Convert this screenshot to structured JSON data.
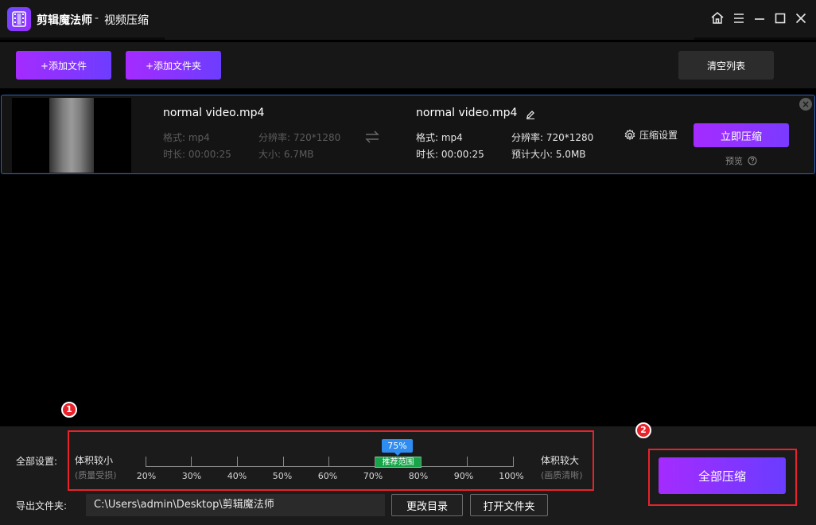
{
  "titlebar": {
    "app_name": "剪辑魔法师",
    "separator": "-",
    "page_title": "视频压缩"
  },
  "toolbar": {
    "add_file": "+添加文件",
    "add_folder": "+添加文件夹",
    "clear_list": "清空列表"
  },
  "file": {
    "source": {
      "name": "normal video.mp4",
      "format": "格式: mp4",
      "resolution": "分辨率: 720*1280",
      "duration": "时长: 00:00:25",
      "size": "大小: 6.7MB"
    },
    "target": {
      "name": "normal video.mp4",
      "format": "格式: mp4",
      "resolution": "分辨率: 720*1280",
      "duration": "时长: 00:00:25",
      "estimated_size": "预计大小: 5.0MB"
    },
    "settings_label": "压缩设置",
    "compress_now": "立即压缩",
    "preview": "预览"
  },
  "bottom": {
    "markers": [
      "1",
      "2"
    ],
    "all_settings_label": "全部设置:",
    "smaller": "体积较小",
    "smaller_note": "(质量受损)",
    "larger": "体积较大",
    "larger_note": "(画质清晰)",
    "current_value": "75%",
    "current_fraction": 0.75,
    "recommended": "推荐范围",
    "ticks": [
      "20%",
      "30%",
      "40%",
      "50%",
      "60%",
      "70%",
      "80%",
      "90%",
      "100%"
    ],
    "export_label": "导出文件夹:",
    "export_path": "C:\\Users\\admin\\Desktop\\剪辑魔法师",
    "change_dir": "更改目录",
    "open_folder": "打开文件夹",
    "compress_all": "全部压缩"
  },
  "colors": {
    "accent_purple": "#a52bff",
    "accent_violet": "#6d3dff",
    "selected_border": "#2f63b5",
    "recommend_green": "#18a54a",
    "badge_blue": "#2f8cf0",
    "highlight_red": "#e8222a"
  }
}
